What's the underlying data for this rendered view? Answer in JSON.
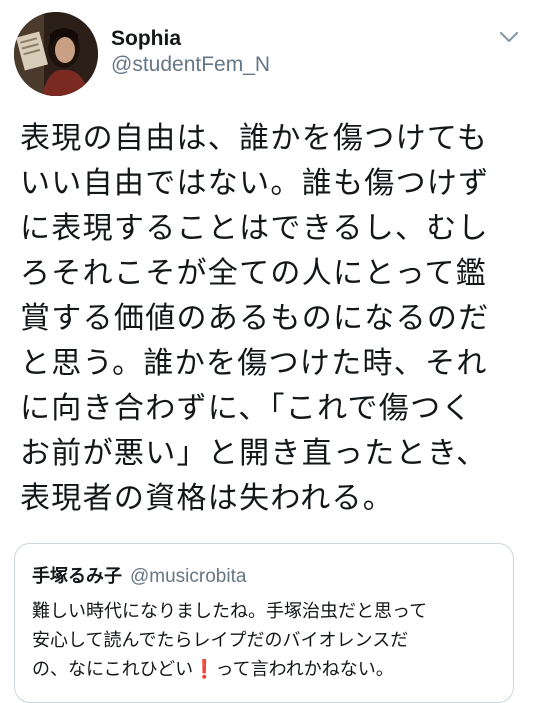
{
  "tweet": {
    "author": {
      "display_name": "Sophia",
      "handle": "@studentFem_N"
    },
    "body_lines": [
      "表現の自由は、誰かを傷つけても",
      "いい自由ではない。誰も傷つけず",
      "に表現することはできるし、むし",
      "ろそれこそが全ての人にとって鑑",
      "賞する価値のあるものになるのだ",
      "と思う。誰かを傷つけた時、それ",
      "に向き合わずに、「これで傷つく",
      "お前が悪い」と開き直ったとき、",
      "表現者の資格は失われる。"
    ]
  },
  "quoted_tweet": {
    "author": {
      "display_name": "手塚るみ子",
      "handle": "@musicrobita"
    },
    "body_lines": [
      "難しい時代になりましたね。手塚治虫だと思って",
      "安心して読んでたらレイプだのバイオレンスだ",
      "の、なにこれひどい"
    ],
    "emoji": "❗",
    "last_line_tail": "って言われかねない。"
  },
  "icons": {
    "menu": "chevron-down-icon",
    "avatar": "avatar-photo"
  },
  "colors": {
    "text": "#14171a",
    "secondary": "#657786",
    "border": "#ccd6dd",
    "emoji": "#d0021b"
  }
}
